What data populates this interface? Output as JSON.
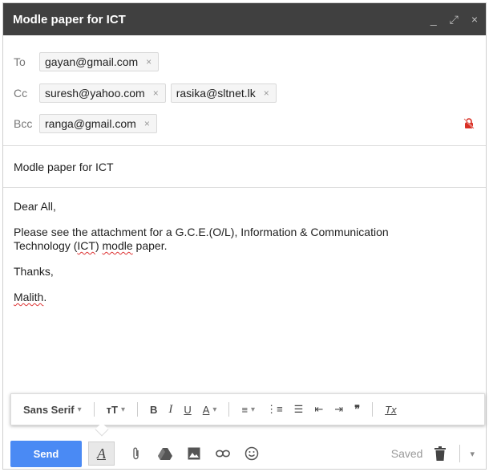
{
  "window": {
    "title": "Modle paper for ICT",
    "minimize": "_",
    "expand": "⤢",
    "close": "×"
  },
  "recipients": {
    "to_label": "To",
    "cc_label": "Cc",
    "bcc_label": "Bcc",
    "to": [
      "gayan@gmail.com"
    ],
    "cc": [
      "suresh@yahoo.com",
      "rasika@sltnet.lk"
    ],
    "bcc": [
      "ranga@gmail.com"
    ],
    "remove_glyph": "×"
  },
  "subject": "Modle paper for ICT",
  "body": {
    "greeting": "Dear All,",
    "line1_pre": "Please see the attachment for a G.C.E.(O/L), Information & Communication",
    "line2_pre": "Technology (",
    "line2_ict": "ICT",
    "line2_mid": ") ",
    "line2_modle": "modle",
    "line2_post": " paper.",
    "thanks": "Thanks,",
    "signature": "Malith",
    "signature_end": "."
  },
  "format_toolbar": {
    "font": "Sans Serif",
    "dropdown": "▾",
    "size_icon": "ᴛT",
    "bold": "B",
    "italic": "I",
    "underline": "U",
    "text_color": "A",
    "align": "≡",
    "numbered_list": "⋮≡",
    "bulleted_list": "☰",
    "indent_less": "⇤",
    "indent_more": "⇥",
    "quote": "❞",
    "clear_format": "Tx"
  },
  "bottom_bar": {
    "send_label": "Send",
    "format_toggle": "A",
    "attach_icon": "paperclip-icon",
    "drive_icon": "drive-icon",
    "photo_icon": "photo-icon",
    "link_icon": "link-icon",
    "emoji_icon": "emoji-icon",
    "saved_label": "Saved",
    "more": "▾"
  },
  "colors": {
    "titlebar": "#404040",
    "send": "#4a8af4",
    "lock": "#d93025"
  }
}
